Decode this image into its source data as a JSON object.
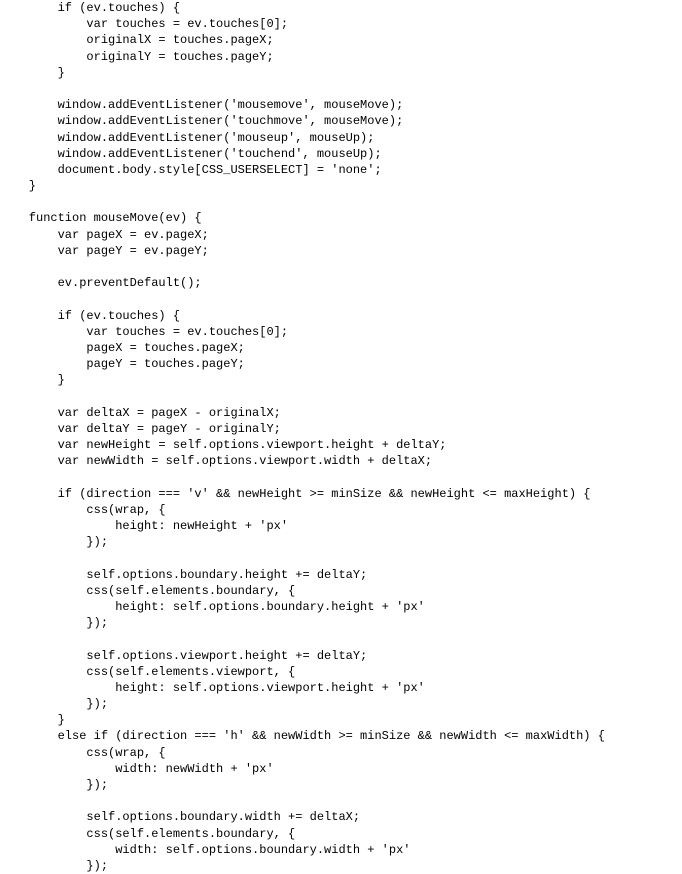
{
  "code_lines": [
    "        if (ev.touches) {",
    "            var touches = ev.touches[0];",
    "            originalX = touches.pageX;",
    "            originalY = touches.pageY;",
    "        }",
    "",
    "        window.addEventListener('mousemove', mouseMove);",
    "        window.addEventListener('touchmove', mouseMove);",
    "        window.addEventListener('mouseup', mouseUp);",
    "        window.addEventListener('touchend', mouseUp);",
    "        document.body.style[CSS_USERSELECT] = 'none';",
    "    }",
    "",
    "    function mouseMove(ev) {",
    "        var pageX = ev.pageX;",
    "        var pageY = ev.pageY;",
    "",
    "        ev.preventDefault();",
    "",
    "        if (ev.touches) {",
    "            var touches = ev.touches[0];",
    "            pageX = touches.pageX;",
    "            pageY = touches.pageY;",
    "        }",
    "",
    "        var deltaX = pageX - originalX;",
    "        var deltaY = pageY - originalY;",
    "        var newHeight = self.options.viewport.height + deltaY;",
    "        var newWidth = self.options.viewport.width + deltaX;",
    "",
    "        if (direction === 'v' && newHeight >= minSize && newHeight <= maxHeight) {",
    "            css(wrap, {",
    "                height: newHeight + 'px'",
    "            });",
    "",
    "            self.options.boundary.height += deltaY;",
    "            css(self.elements.boundary, {",
    "                height: self.options.boundary.height + 'px'",
    "            });",
    "",
    "            self.options.viewport.height += deltaY;",
    "            css(self.elements.viewport, {",
    "                height: self.options.viewport.height + 'px'",
    "            });",
    "        }",
    "        else if (direction === 'h' && newWidth >= minSize && newWidth <= maxWidth) {",
    "            css(wrap, {",
    "                width: newWidth + 'px'",
    "            });",
    "",
    "            self.options.boundary.width += deltaX;",
    "            css(self.elements.boundary, {",
    "                width: self.options.boundary.width + 'px'",
    "            });"
  ]
}
